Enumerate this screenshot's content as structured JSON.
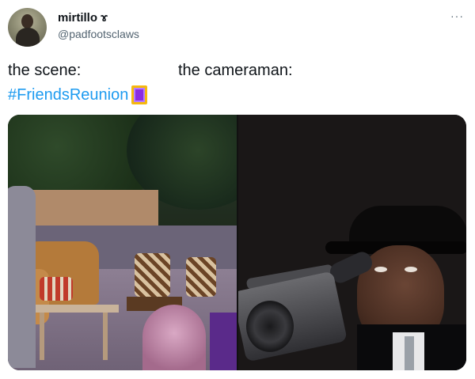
{
  "tweet": {
    "display_name": "mirtillo",
    "name_badge": "ɤ",
    "handle": "@padfootsclaws",
    "more_label": "···",
    "text_left": "the scene:",
    "text_right": "the cameraman:",
    "hashtag": "#FriendsReunion"
  },
  "media": {
    "left_image": "photo-scene",
    "right_image": "photo-cameraman"
  },
  "colors": {
    "hashtag": "#1d9bf0",
    "secondary_text": "#536471",
    "primary_text": "#0f1419"
  }
}
